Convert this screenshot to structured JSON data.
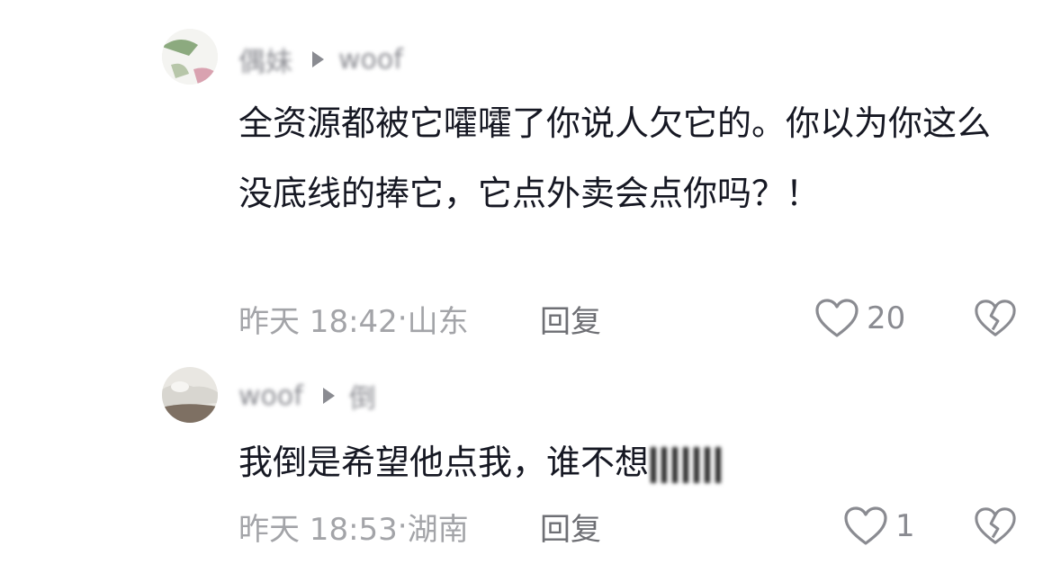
{
  "comments": [
    {
      "author": "偶妹",
      "reply_to": "woof",
      "text": "全资源都被它嚯嚯了你说人欠它的。你以为你这么没底线的捧它，它点外卖会点你吗？！",
      "time": "昨天 18:42",
      "location": "山东",
      "reply_label": "回复",
      "likes": "20"
    },
    {
      "author": "woof",
      "reply_to": "倒",
      "text": "我倒是希望他点我，谁不想",
      "time": "昨天 18:53",
      "location": "湖南",
      "reply_label": "回复",
      "likes": "1"
    }
  ],
  "separator": "·",
  "icons": {
    "like": "heart-outline-icon",
    "dislike": "broken-heart-icon",
    "reply_arrow": "triangle-right-icon"
  },
  "colors": {
    "text": "#161823",
    "meta": "#a3a4a8",
    "icon": "#8a8b91"
  }
}
